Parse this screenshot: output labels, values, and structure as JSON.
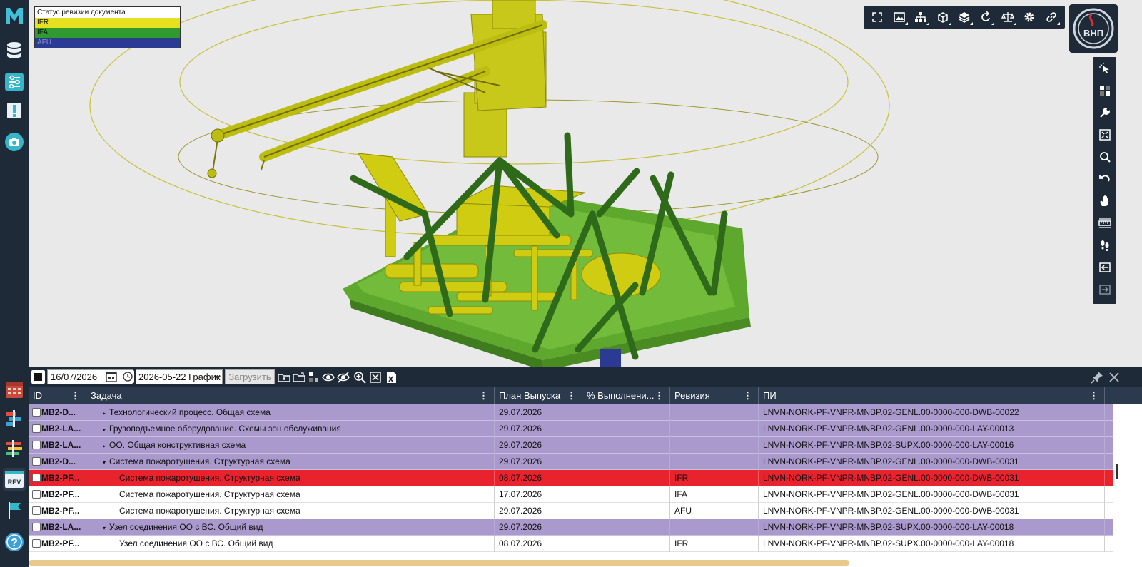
{
  "legend": {
    "title": "Статус ревизии документа",
    "items": [
      {
        "label": "IFR",
        "color": "#e6e01f"
      },
      {
        "label": "IFA",
        "color": "#2f9a2f"
      },
      {
        "label": "AFU",
        "color": "#2b3b93"
      }
    ]
  },
  "toolbar": {
    "buttons": [
      "fullscreen-icon",
      "image-icon",
      "hierarchy-icon",
      "cube-icon",
      "layers-icon",
      "rotate-icon",
      "scale-icon",
      "gear-icon",
      "link-icon"
    ]
  },
  "logo": {
    "text": "ВНП"
  },
  "sidebar": {
    "items": [
      "logo-m-icon",
      "database-icon",
      "sliders-icon",
      "exclamation-icon",
      "camera-icon",
      "calendar-icon",
      "gantt-icon",
      "timeline-icon",
      "rev-icon",
      "flag-icon",
      "help-icon"
    ]
  },
  "right_tools": {
    "buttons": [
      "select-icon",
      "grid-icon",
      "wrench-icon",
      "fit-icon",
      "search-icon",
      "undo-icon",
      "hand-icon",
      "measure-icon",
      "walk-icon",
      "enter-icon",
      "exit-icon"
    ]
  },
  "panel": {
    "date_value": "16/07/2026",
    "schedule_value": "2026-05-22 График",
    "load_label": "Загрузить"
  },
  "table": {
    "columns": [
      "ID",
      "Задача",
      "План Выпуска",
      "% Выполнени...",
      "Ревизия",
      "ПИ"
    ],
    "rows": [
      {
        "id": "MB2-D...",
        "task": "Технологический процесс. Общая схема",
        "plan": "29.07.2026",
        "pct": "",
        "rev": "",
        "pi": "LNVN-NORK-PF-VNPR-MNBP.02-GENL.00-0000-000-DWB-00022",
        "style": "purple",
        "tri": "▸",
        "indent": 1
      },
      {
        "id": "MB2-LA...",
        "task": "Грузоподъемное оборудование. Схемы зон обслуживания",
        "plan": "29.07.2026",
        "pct": "",
        "rev": "",
        "pi": "LNVN-NORK-PF-VNPR-MNBP.02-GENL.00-0000-000-LAY-00013",
        "style": "purple",
        "tri": "▸",
        "indent": 1
      },
      {
        "id": "MB2-LA...",
        "task": "ОО. Общая конструктивная схема",
        "plan": "29.07.2026",
        "pct": "",
        "rev": "",
        "pi": "LNVN-NORK-PF-VNPR-MNBP.02-SUPX.00-0000-000-LAY-00016",
        "style": "purple",
        "tri": "▸",
        "indent": 1
      },
      {
        "id": "MB2-D...",
        "task": "Система пожаротушения. Структурная схема",
        "plan": "29.07.2026",
        "pct": "",
        "rev": "",
        "pi": "LNVN-NORK-PF-VNPR-MNBP.02-GENL.00-0000-000-DWB-00031",
        "style": "purple",
        "tri": "▾",
        "indent": 1
      },
      {
        "id": "MB2-PF...",
        "task": "Система пожаротушения. Структурная схема",
        "plan": "08.07.2026",
        "pct": "",
        "rev": "IFR",
        "pi": "LNVN-NORK-PF-VNPR-MNBP.02-GENL.00-0000-000-DWB-00031",
        "style": "red",
        "tri": "",
        "indent": 2
      },
      {
        "id": "MB2-PF...",
        "task": "Система пожаротушения. Структурная схема",
        "plan": "17.07.2026",
        "pct": "",
        "rev": "IFA",
        "pi": "LNVN-NORK-PF-VNPR-MNBP.02-GENL.00-0000-000-DWB-00031",
        "style": "white",
        "tri": "",
        "indent": 2
      },
      {
        "id": "MB2-PF...",
        "task": "Система пожаротушения. Структурная схема",
        "plan": "29.07.2026",
        "pct": "",
        "rev": "AFU",
        "pi": "LNVN-NORK-PF-VNPR-MNBP.02-GENL.00-0000-000-DWB-00031",
        "style": "white",
        "tri": "",
        "indent": 2
      },
      {
        "id": "MB2-LA...",
        "task": "Узел соединения ОО с ВС. Общий вид",
        "plan": "29.07.2026",
        "pct": "",
        "rev": "",
        "pi": "LNVN-NORK-PF-VNPR-MNBP.02-SUPX.00-0000-000-LAY-00018",
        "style": "purple",
        "tri": "▾",
        "indent": 1
      },
      {
        "id": "MB2-PF...",
        "task": "Узел соединения ОО с ВС. Общий вид",
        "plan": "08.07.2026",
        "pct": "",
        "rev": "IFR",
        "pi": "LNVN-NORK-PF-VNPR-MNBP.02-SUPX.00-0000-000-LAY-00018",
        "style": "white",
        "tri": "",
        "indent": 2
      }
    ]
  }
}
